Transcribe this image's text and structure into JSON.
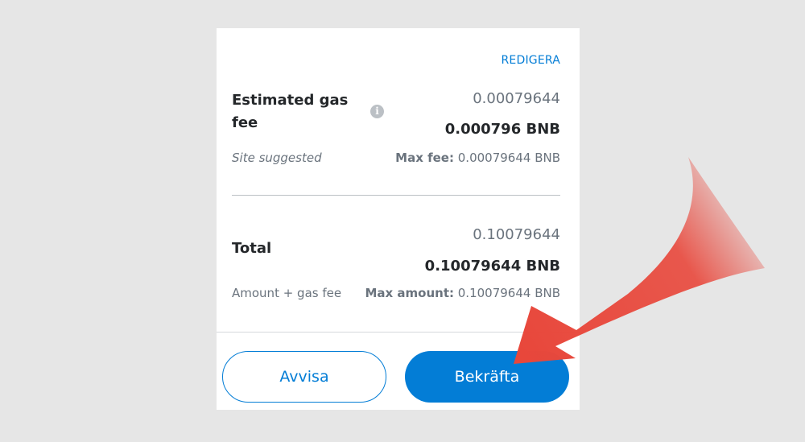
{
  "panel": {
    "edit_link": "REDIGERA",
    "gas_fee": {
      "title_line1": "Estimated gas",
      "title_line2": "fee",
      "info_icon": "info-icon",
      "value_secondary": "0.00079644",
      "value_primary": "0.000796 BNB",
      "note": "Site suggested",
      "max_label": "Max fee:",
      "max_value": "0.00079644 BNB"
    },
    "total": {
      "title": "Total",
      "value_secondary": "0.10079644",
      "value_primary": "0.10079644 BNB",
      "note": "Amount + gas fee",
      "max_label": "Max amount:",
      "max_value": "0.10079644 BNB"
    },
    "buttons": {
      "reject_label": "Avvisa",
      "confirm_label": "Bekräfta"
    }
  },
  "colors": {
    "background": "#e6e6e6",
    "panel": "#ffffff",
    "accent": "#037dd6",
    "arrow": "#e8473b"
  }
}
